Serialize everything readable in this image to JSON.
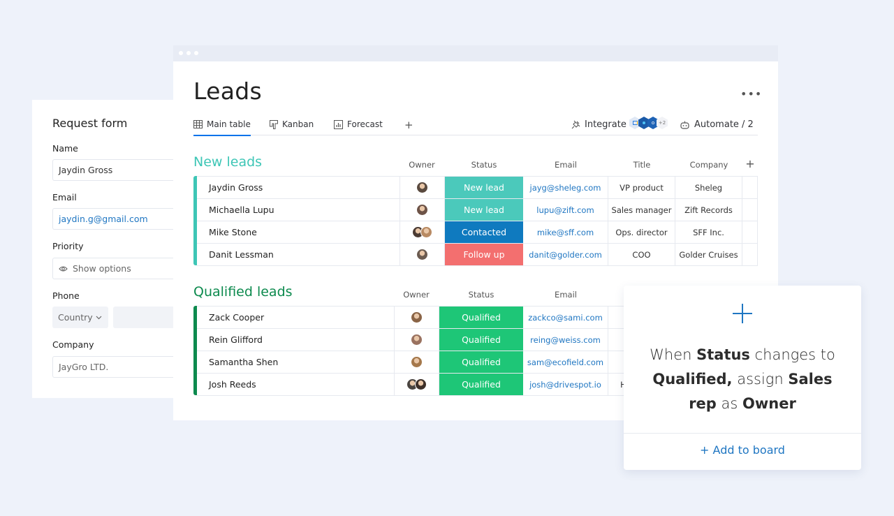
{
  "board": {
    "title": "Leads",
    "more_label": "•••",
    "tabs": [
      {
        "label": "Main table",
        "icon": "table-icon",
        "active": true
      },
      {
        "label": "Kanban",
        "icon": "kanban-icon",
        "active": false
      },
      {
        "label": "Forecast",
        "icon": "chart-icon",
        "active": false
      }
    ],
    "add_tab_label": "+",
    "integrate_label": "Integrate",
    "integrations_extra": "+2",
    "automate_label": "Automate / 2"
  },
  "new_leads": {
    "title": "New leads",
    "color": "#3ec6b6",
    "columns": [
      "Owner",
      "Status",
      "Email",
      "Title",
      "Company"
    ],
    "add_column_label": "+",
    "rows": [
      {
        "name": "Jaydin Gross",
        "status": "New lead",
        "status_color": "#4bc9bb",
        "email": "jayg@sheleg.com",
        "title": "VP product",
        "company": "Sheleg",
        "owners": [
          "#5a4a3f"
        ]
      },
      {
        "name": "Michaella Lupu",
        "status": "New lead",
        "status_color": "#4bc9bb",
        "email": "lupu@zift.com",
        "title": "Sales manager",
        "company": "Zift Records",
        "owners": [
          "#6d5347"
        ]
      },
      {
        "name": "Mike Stone",
        "status": "Contacted",
        "status_color": "#0f7abf",
        "email": "mike@sff.com",
        "title": "Ops. director",
        "company": "SFF Inc.",
        "owners": [
          "#4b3b33",
          "#b88a63"
        ]
      },
      {
        "name": "Danit Lessman",
        "status": "Follow up",
        "status_color": "#f36f6f",
        "email": "danit@golder.com",
        "title": "COO",
        "company": "Golder Cruises",
        "owners": [
          "#6b5b50"
        ]
      }
    ]
  },
  "qualified_leads": {
    "title": "Qualified leads",
    "color": "#0d8a4e",
    "columns": [
      "Owner",
      "Status",
      "Email"
    ],
    "rows": [
      {
        "name": "Zack Cooper",
        "status": "Qualified",
        "status_color": "#1ec677",
        "email": "zackco@sami.com",
        "title": "",
        "owners": [
          "#8a6446"
        ]
      },
      {
        "name": "Rein Glifford",
        "status": "Qualified",
        "status_color": "#1ec677",
        "email": "reing@weiss.com",
        "title": "",
        "owners": [
          "#9a7260"
        ]
      },
      {
        "name": "Samantha Shen",
        "status": "Qualified",
        "status_color": "#1ec677",
        "email": "sam@ecofield.com",
        "title": "",
        "owners": [
          "#a5784b"
        ]
      },
      {
        "name": "Josh Reeds",
        "status": "Qualified",
        "status_color": "#1ec677",
        "email": "josh@drivespot.io",
        "title": "He",
        "owners": [
          "#4a4440",
          "#3d2f28"
        ]
      }
    ]
  },
  "request_form": {
    "title": "Request form",
    "fields": {
      "name": {
        "label": "Name",
        "value": "Jaydin Gross"
      },
      "email": {
        "label": "Email",
        "value": "jaydin.g@gmail.com"
      },
      "priority": {
        "label": "Priority",
        "value": "Show options"
      },
      "phone": {
        "label": "Phone",
        "country": "Country"
      },
      "company": {
        "label": "Company",
        "value": "JayGro LTD."
      }
    }
  },
  "automation": {
    "parts": [
      {
        "text": "When ",
        "bold": false
      },
      {
        "text": "Status",
        "bold": true
      },
      {
        "text": " changes to ",
        "bold": false
      },
      {
        "text": "Qualified,",
        "bold": true
      },
      {
        "text": " assign ",
        "bold": false
      },
      {
        "text": "Sales rep",
        "bold": true
      },
      {
        "text": " as ",
        "bold": false
      },
      {
        "text": "Owner",
        "bold": true
      }
    ],
    "add_label": "+ Add to board"
  }
}
